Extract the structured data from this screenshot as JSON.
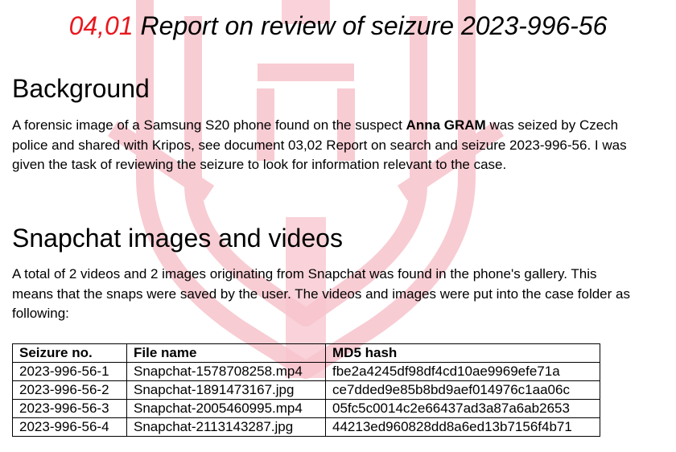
{
  "document": {
    "number": "04,01",
    "title": "Report on review of seizure 2023-996-56"
  },
  "background": {
    "heading": "Background",
    "text_before": "A forensic image of a Samsung S20 phone found on the suspect ",
    "suspect_name": "Anna GRAM",
    "text_after": " was seized by Czech police and shared with Kripos, see document 03,02 Report on search and seizure 2023-996-56. I was given the task of reviewing the seizure to look for information relevant to the case."
  },
  "snapchat": {
    "heading": "Snapchat images and videos",
    "text": "A total of 2 videos and 2 images originating from Snapchat was found in the phone's gallery. This means that the snaps were saved by the user. The videos and images were put into the case folder as following:"
  },
  "table": {
    "headers": [
      "Seizure no.",
      "File name",
      "MD5 hash"
    ],
    "rows": [
      [
        "2023-996-56-1",
        "Snapchat-1578708258.mp4",
        "fbe2a4245df98df4cd10ae9969efe71a"
      ],
      [
        "2023-996-56-2",
        "Snapchat-1891473167.jpg",
        "ce7dded9e85b8bd9aef014976c1aa06c"
      ],
      [
        "2023-996-56-3",
        "Snapchat-2005460995.mp4",
        "05fc5c0014c2e66437ad3a87a6ab2653"
      ],
      [
        "2023-996-56-4",
        "Snapchat-2113143287.jpg",
        "44213ed960828dd8a6ed13b7156f4b71"
      ]
    ]
  },
  "colors": {
    "document_number": "#e8191f",
    "watermark": "#f7c4cc"
  },
  "icons": {
    "watermark": "police-crest-watermark"
  }
}
